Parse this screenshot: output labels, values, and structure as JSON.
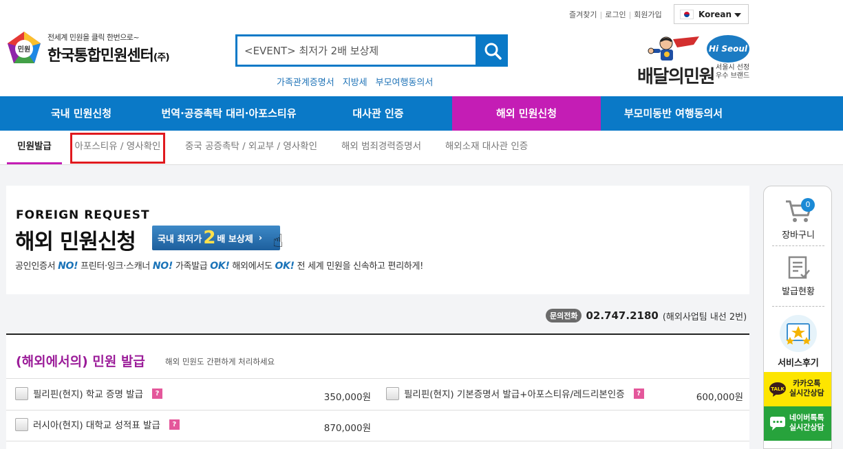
{
  "header": {
    "top_links": [
      "즐겨찾기",
      "로그인",
      "회원가입"
    ],
    "language": "Korean",
    "logo_mark_text": "민원",
    "slogan": "전세계 민원을 클릭 한번으로~",
    "brand_name": "한국통합민원센터",
    "brand_suffix": "(주)",
    "search_value": "<EVENT> 최저가 2배 보상제",
    "quick_links": [
      "가족관계증명서",
      "지방세",
      "부모여행동의서"
    ],
    "delivery_brand": "배달의민원",
    "hiseoul": "Hi Seoul",
    "delivery_sub1": "서울시 선정",
    "delivery_sub2": "우수 브랜드"
  },
  "nav": {
    "items": [
      "국내 민원신청",
      "번역·공증촉탁 대리·아포스티유",
      "대사관 인증",
      "해외 민원신청",
      "부모미동반 여행동의서"
    ],
    "active": "해외 민원신청"
  },
  "subnav": {
    "items": [
      "민원발급",
      "아포스티유 / 영사확인",
      "중국 공증촉탁 / 외교부 / 영사확인",
      "해외 범죄경력증명서",
      "해외소재 대사관 인증"
    ]
  },
  "banner": {
    "en_title": "FOREIGN REQUEST",
    "title": "해외 민원신청",
    "promo_pre": "국내 최저가",
    "promo_big": "2",
    "promo_post": "배 보상제",
    "desc": {
      "p1": "공인인증서 ",
      "b1": "NO!",
      "p2": " 프린터·잉크·스캐너 ",
      "b2": "NO!",
      "p3": " 가족발급 ",
      "b3": "OK!",
      "p4": " 해외에서도 ",
      "b4": "OK!",
      "p5": " 전 세계 민원을 신속하고 편리하게!"
    }
  },
  "contact": {
    "badge": "문의전화",
    "number": "02.747.2180",
    "note": "(해외사업팀 내선 2번)"
  },
  "section": {
    "title": "(해외에서의) 민원 발급",
    "subtitle": "해외 민원도 간편하게 처리하세요",
    "items": [
      {
        "name": "필리핀(현지) 학교 증명 발급",
        "price": "350,000원"
      },
      {
        "name": "필리핀(현지) 기본증명서 발급+아포스티유/레드리본인증",
        "price": "600,000원"
      },
      {
        "name": "러시아(현지) 대학교 성적표 발급",
        "price": "870,000원"
      }
    ],
    "qmark": "?"
  },
  "quick_menu": {
    "cart_count": "0",
    "cart": "장바구니",
    "status": "발급현황",
    "review": "서비스후기",
    "kakao_line1": "카카오톡",
    "kakao_line2": "실시간상담",
    "naver_line1": "네이버톡톡",
    "naver_line2": "실시간상담"
  },
  "colors": {
    "primary_blue": "#0a79c7",
    "active_magenta": "#c41db5",
    "section_title_purple": "#9b1c99",
    "highlight_red": "#e0191e",
    "kakao_yellow": "#fde500",
    "naver_green": "#27a33c"
  }
}
